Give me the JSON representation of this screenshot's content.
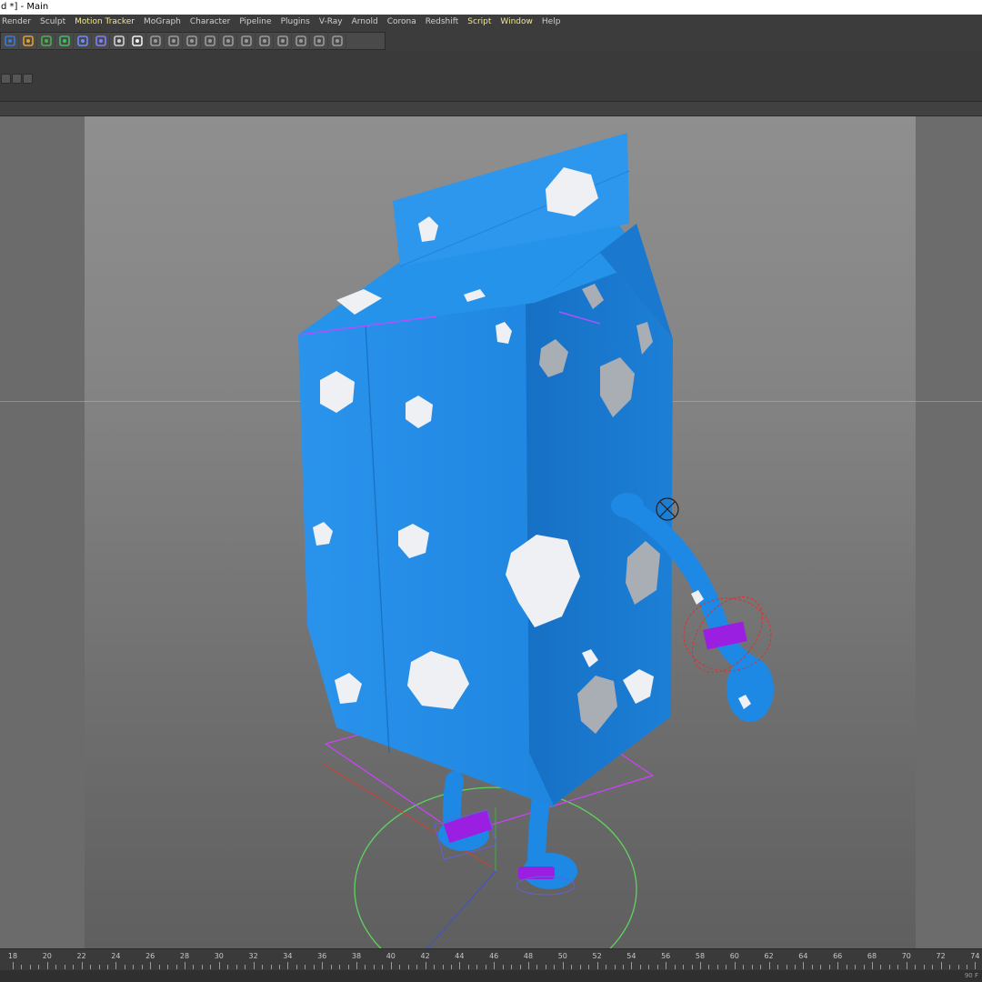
{
  "window": {
    "title": "d *] - Main"
  },
  "menu": {
    "items": [
      {
        "label": "Render",
        "highlight": false
      },
      {
        "label": "Sculpt",
        "highlight": false
      },
      {
        "label": "Motion Tracker",
        "highlight": true
      },
      {
        "label": "MoGraph",
        "highlight": false
      },
      {
        "label": "Character",
        "highlight": false
      },
      {
        "label": "Pipeline",
        "highlight": false
      },
      {
        "label": "Plugins",
        "highlight": false
      },
      {
        "label": "V-Ray",
        "highlight": false
      },
      {
        "label": "Arnold",
        "highlight": false
      },
      {
        "label": "Corona",
        "highlight": false
      },
      {
        "label": "Redshift",
        "highlight": false
      },
      {
        "label": "Script",
        "highlight": true
      },
      {
        "label": "Window",
        "highlight": true
      },
      {
        "label": "Help",
        "highlight": false
      }
    ]
  },
  "toolbar": {
    "tools": [
      "cube-icon",
      "pen-icon",
      "subdivide-icon",
      "array-icon",
      "deformer-icon",
      "floor-icon",
      "camera-icon",
      "light-icon",
      "grid-icon",
      "ruler-icon",
      "shield-icon",
      "align-icon",
      "fork-icon",
      "tag-icon",
      "box-icon",
      "lattice-icon",
      "grid-pattern-icon",
      "grid-pattern-icon-2",
      "grid-pattern-icon-3"
    ]
  },
  "viewport": {
    "object": "milk-carton-character",
    "colors": {
      "carton": "#1e88e5",
      "spots": "#eef0f4",
      "selection": "#d040ff",
      "ground_circle": "#5fd35f",
      "controller": "#e03030"
    }
  },
  "timeline": {
    "ticks": [
      "18",
      "20",
      "22",
      "24",
      "26",
      "28",
      "30",
      "32",
      "34",
      "36",
      "38",
      "40",
      "42",
      "44",
      "46",
      "48",
      "50",
      "52",
      "54",
      "56",
      "58",
      "60",
      "62",
      "64",
      "66",
      "68",
      "70",
      "72",
      "74"
    ],
    "end_frame": "90 F"
  }
}
